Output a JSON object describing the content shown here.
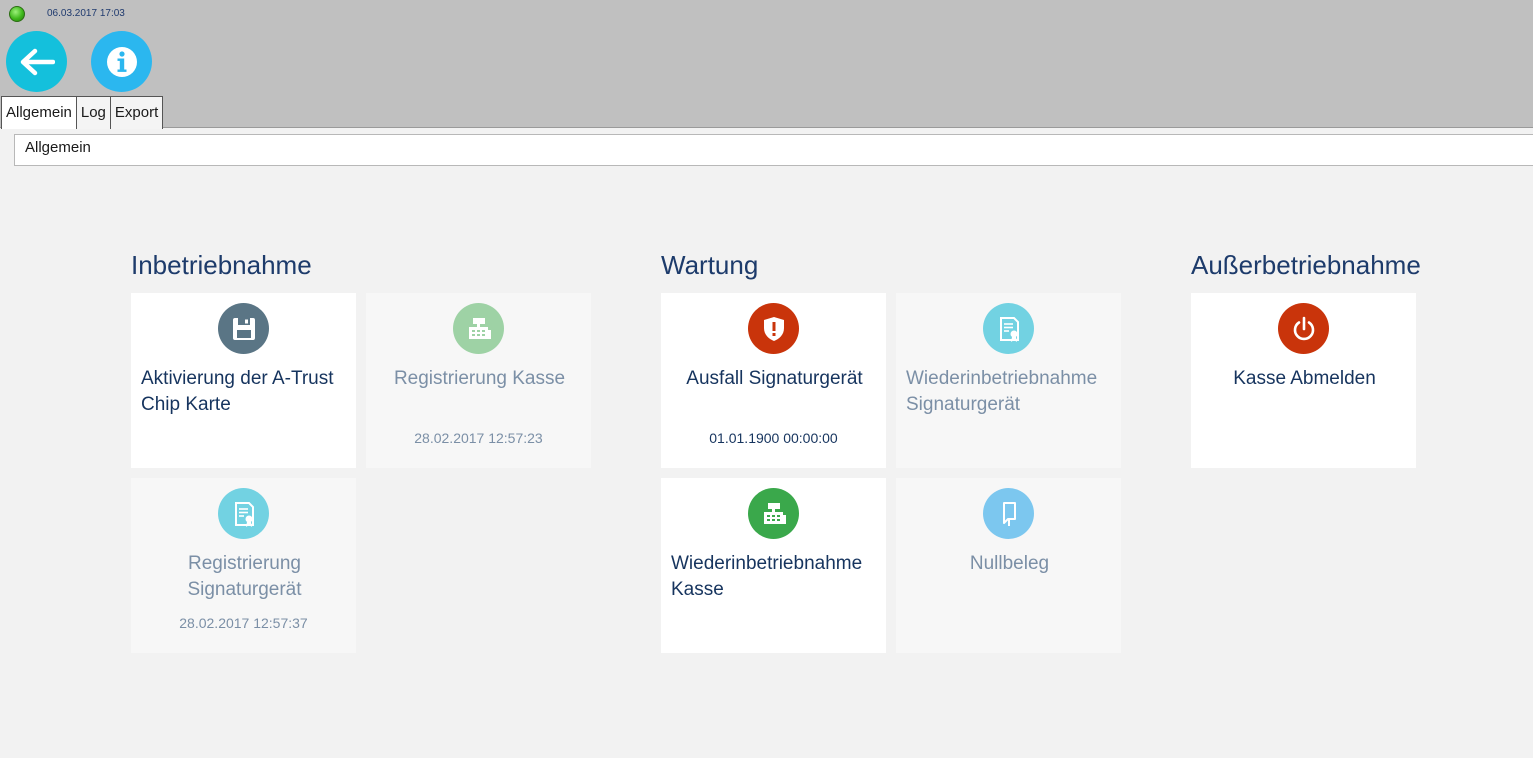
{
  "status": {
    "datetime": "06.03.2017 17:03"
  },
  "tabs": [
    {
      "label": "Allgemein"
    },
    {
      "label": "Log"
    },
    {
      "label": "Export"
    }
  ],
  "section_header": "Allgemein",
  "groups": {
    "inbetriebnahme": {
      "title": "Inbetriebnahme"
    },
    "wartung": {
      "title": "Wartung"
    },
    "ausserbetriebnahme": {
      "title": "Außerbetriebnahme"
    }
  },
  "tiles": {
    "aktivierung": {
      "label": "Aktivierung der A-Trust Chip Karte",
      "icon": "save-icon",
      "color": "#5a7585"
    },
    "registrierung_kasse": {
      "label": "Registrierung Kasse",
      "sub": "28.02.2017 12:57:23",
      "icon": "cash-register-icon",
      "color": "#9ed2a5"
    },
    "registrierung_signaturgeraet": {
      "label": "Registrierung Signaturgerät",
      "sub": "28.02.2017 12:57:37",
      "icon": "certificate-icon",
      "color": "#72d2e2"
    },
    "ausfall": {
      "label": "Ausfall Signaturgerät",
      "sub": "01.01.1900 00:00:00",
      "icon": "shield-alert-icon",
      "color": "#c9340b"
    },
    "wiederinbetriebnahme_sig": {
      "label": "Wiederinbetriebnahme Signaturgerät",
      "icon": "certificate-icon",
      "color": "#72d2e2"
    },
    "wiederinbetriebnahme_kasse": {
      "label": "Wiederinbetriebnahme Kasse",
      "icon": "cash-register-icon",
      "color": "#3aa84b"
    },
    "nullbeleg": {
      "label": "Nullbeleg",
      "icon": "receipt-icon",
      "color": "#7cc7ef"
    },
    "abmelden": {
      "label": "Kasse Abmelden",
      "icon": "power-icon",
      "color": "#c9340b"
    }
  }
}
